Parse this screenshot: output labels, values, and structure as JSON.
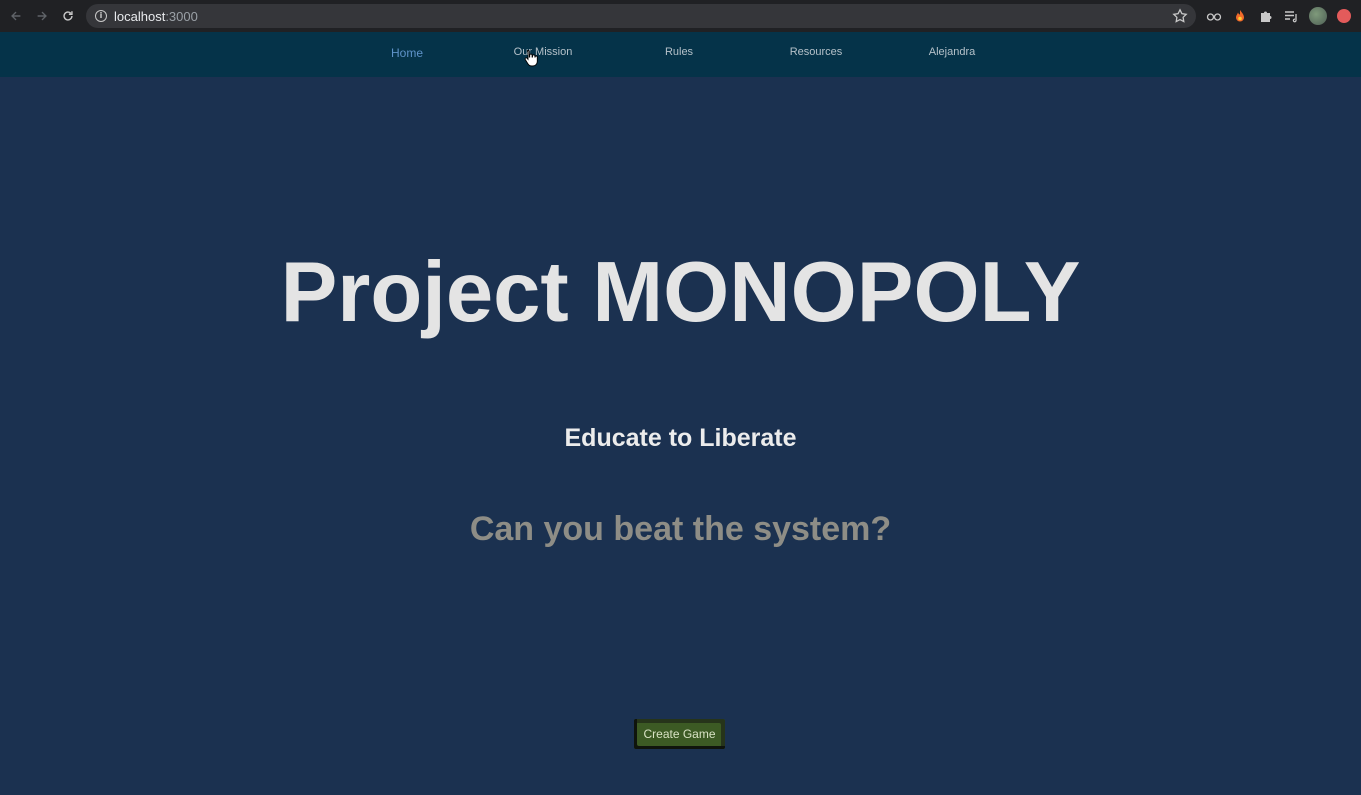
{
  "browser": {
    "url_host": "localhost",
    "url_port": ":3000"
  },
  "nav": {
    "items": [
      {
        "label": "Home",
        "active": true
      },
      {
        "label": "Our Mission",
        "active": false
      },
      {
        "label": "Rules",
        "active": false
      },
      {
        "label": "Resources",
        "active": false
      },
      {
        "label": "Alejandra",
        "active": false
      }
    ]
  },
  "hero": {
    "title": "Project MONOPOLY",
    "tagline": "Educate to Liberate",
    "question": "Can you beat the system?"
  },
  "actions": {
    "create_game_label": "Create Game"
  },
  "colors": {
    "page_bg": "#1b3150",
    "navbar_bg": "#053349",
    "nav_active": "#5f93c9",
    "button_bg": "#3c5a24"
  }
}
